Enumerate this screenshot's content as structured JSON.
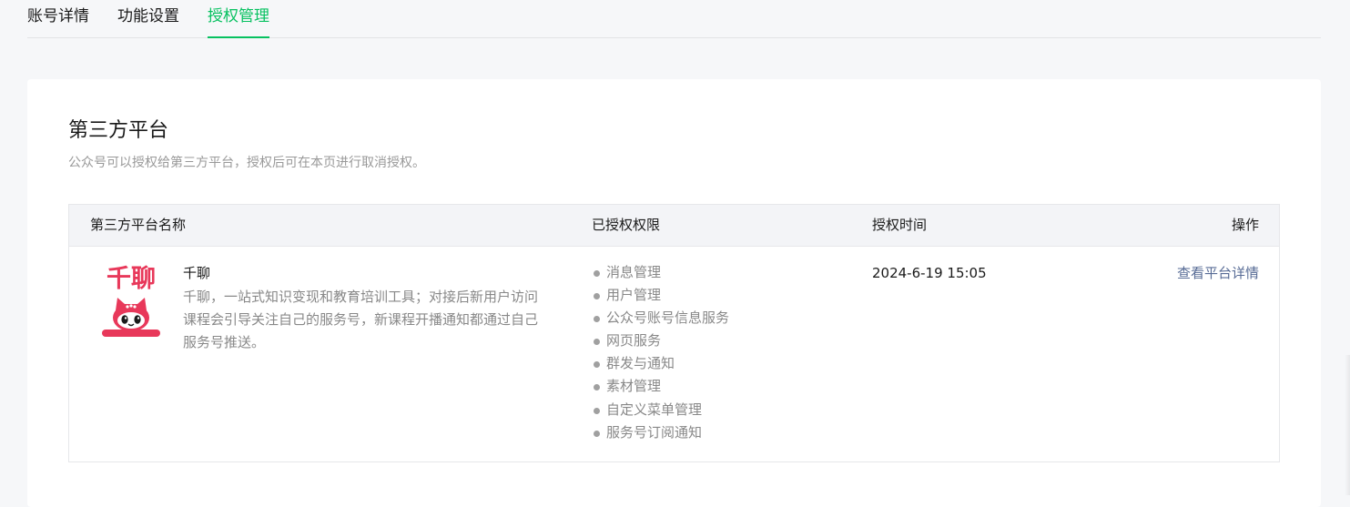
{
  "tabs": [
    {
      "label": "账号详情"
    },
    {
      "label": "功能设置"
    },
    {
      "label": "授权管理",
      "active": true
    }
  ],
  "section": {
    "title": "第三方平台",
    "description": "公众号可以授权给第三方平台，授权后可在本页进行取消授权。"
  },
  "table": {
    "headers": [
      "第三方平台名称",
      "已授权权限",
      "授权时间",
      "操作"
    ],
    "rows": [
      {
        "logo_text": "千聊",
        "name": "千聊",
        "description": "千聊，一站式知识变现和教育培训工具；对接后新用户访问课程会引导关注自己的服务号，新课程开播通知都通过自己服务号推送。",
        "permissions": [
          "消息管理",
          "用户管理",
          "公众号账号信息服务",
          "网页服务",
          "群发与通知",
          "素材管理",
          "自定义菜单管理",
          "服务号订阅通知"
        ],
        "time": "2024-6-19 15:05",
        "action": "查看平台详情"
      }
    ]
  },
  "colors": {
    "accent": "#07c160",
    "link": "#576b95",
    "logo": "#e8385a"
  }
}
